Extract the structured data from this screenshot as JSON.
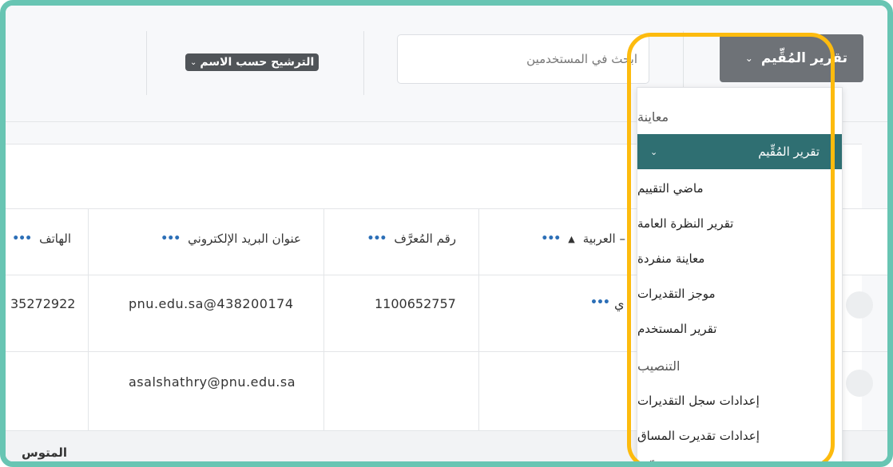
{
  "toolbar": {
    "report_button_label": "تقرير المُقِّيم",
    "search_placeholder": "ابحث في المستخدمين",
    "filter_label": "الترشيح حسب الاسم"
  },
  "table": {
    "headers": {
      "name": "العربية",
      "id_number": "رقم المُعرَّف",
      "email": "عنوان البريد الإلكتروني",
      "phone": "الهاتف"
    },
    "rows": [
      {
        "id_number": "1100652757",
        "email": "pnu.edu.sa@438200174",
        "phone": "35272922",
        "name_fragment": "ي"
      },
      {
        "id_number": "",
        "email": "asalshathry@pnu.edu.sa",
        "phone": "",
        "name_fragment": ""
      }
    ],
    "footer_label": "المتوس"
  },
  "dropdown": {
    "sections": [
      {
        "header": "معاينة",
        "items": [
          {
            "label": "تقرير المُقِّيم",
            "active": true
          },
          {
            "label": "ماضي التقييم"
          },
          {
            "label": "تقرير النظرة العامة"
          },
          {
            "label": "معاينة منفردة"
          },
          {
            "label": "موجز التقديرات"
          },
          {
            "label": "تقرير المستخدم"
          }
        ]
      },
      {
        "header": "التنصيب",
        "items": [
          {
            "label": "إعدادات سجل التقديرات"
          },
          {
            "label": "إعدادات تقديرت المساق"
          },
          {
            "label": "تفضيلات: تقرير المُقِّيم"
          }
        ]
      }
    ]
  },
  "colors": {
    "frame": "#68c5b3",
    "highlight": "#fdbb0e",
    "active_item": "#2f6f72",
    "button": "#6e7277",
    "link_dots": "#2c6fb7"
  }
}
